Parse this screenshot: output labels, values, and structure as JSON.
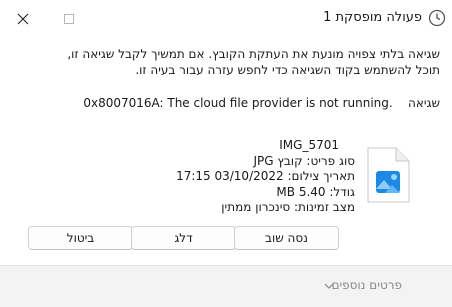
{
  "window": {
    "title": "פעולה מופסקת 1"
  },
  "message": {
    "line1": "שגיאה בלתי צפויה מונעת את העתקת הקובץ. אם תמשיך לקבל שגיאה זו,",
    "line2": "תוכל להשתמש בקוד השגיאה כדי לחפש עזרה עבור בעיה זו.",
    "error_label": "שגיאה",
    "error_code": "0x8007016A: The cloud file provider is not running."
  },
  "file": {
    "icon": "image-file-icon",
    "name": "IMG_5701",
    "type": "סוג פריט: קובץ JPG",
    "date_taken": "תאריך צילום: 03/10/2022 17:15",
    "size": "גודל: 5.40 MB",
    "availability": "מצב זמינות: סינכרון ממתין"
  },
  "buttons": {
    "retry": "נסה שוב",
    "skip": "דלג",
    "cancel": "ביטול"
  },
  "footer": {
    "more_details": "פרטים נוספים"
  },
  "colors": {
    "accent": "#0067c0",
    "footer_text": "#8a8a8a"
  }
}
